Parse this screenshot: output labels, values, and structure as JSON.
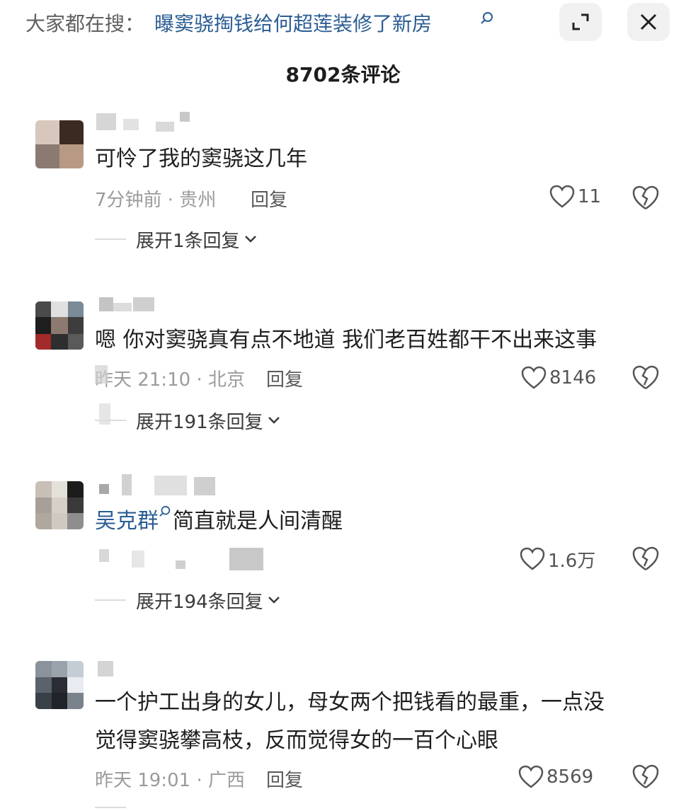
{
  "header": {
    "search_prefix": "大家都在搜：",
    "search_topic": "曝窦骁掏钱给何超莲装修了新房",
    "comments_count": "8702条评论"
  },
  "comments": [
    {
      "text": "可怜了我的窦骁这几年",
      "meta": "7分钟前 · 贵州",
      "reply_label": "回复",
      "likes": "11",
      "expand_label": "展开1条回复"
    },
    {
      "text": "嗯 你对窦骁真有点不地道 我们老百姓都干不出来这事",
      "meta": "昨天 21:10 · 北京",
      "reply_label": "回复",
      "likes": "8146",
      "expand_label": "展开191条回复"
    },
    {
      "mention": "吴克群",
      "text": "简直就是人间清醒",
      "likes": "1.6万",
      "expand_label": "展开194条回复"
    },
    {
      "text_line1": "一个护工出身的女儿，母女两个把钱看的最重，一点没",
      "text_line2": "觉得窦骁攀高枝，反而觉得女的一百个心眼",
      "meta": "昨天 19:01 · 广西",
      "reply_label": "回复",
      "likes": "8569"
    }
  ],
  "icons": {
    "expand": "expand-icon",
    "close": "close-icon",
    "search": "search-icon",
    "like": "heart-icon",
    "dislike": "broken-heart-icon",
    "chevron": "chevron-down-icon"
  },
  "colors": {
    "link": "#2a5d93",
    "meta": "#9b9b9b"
  }
}
